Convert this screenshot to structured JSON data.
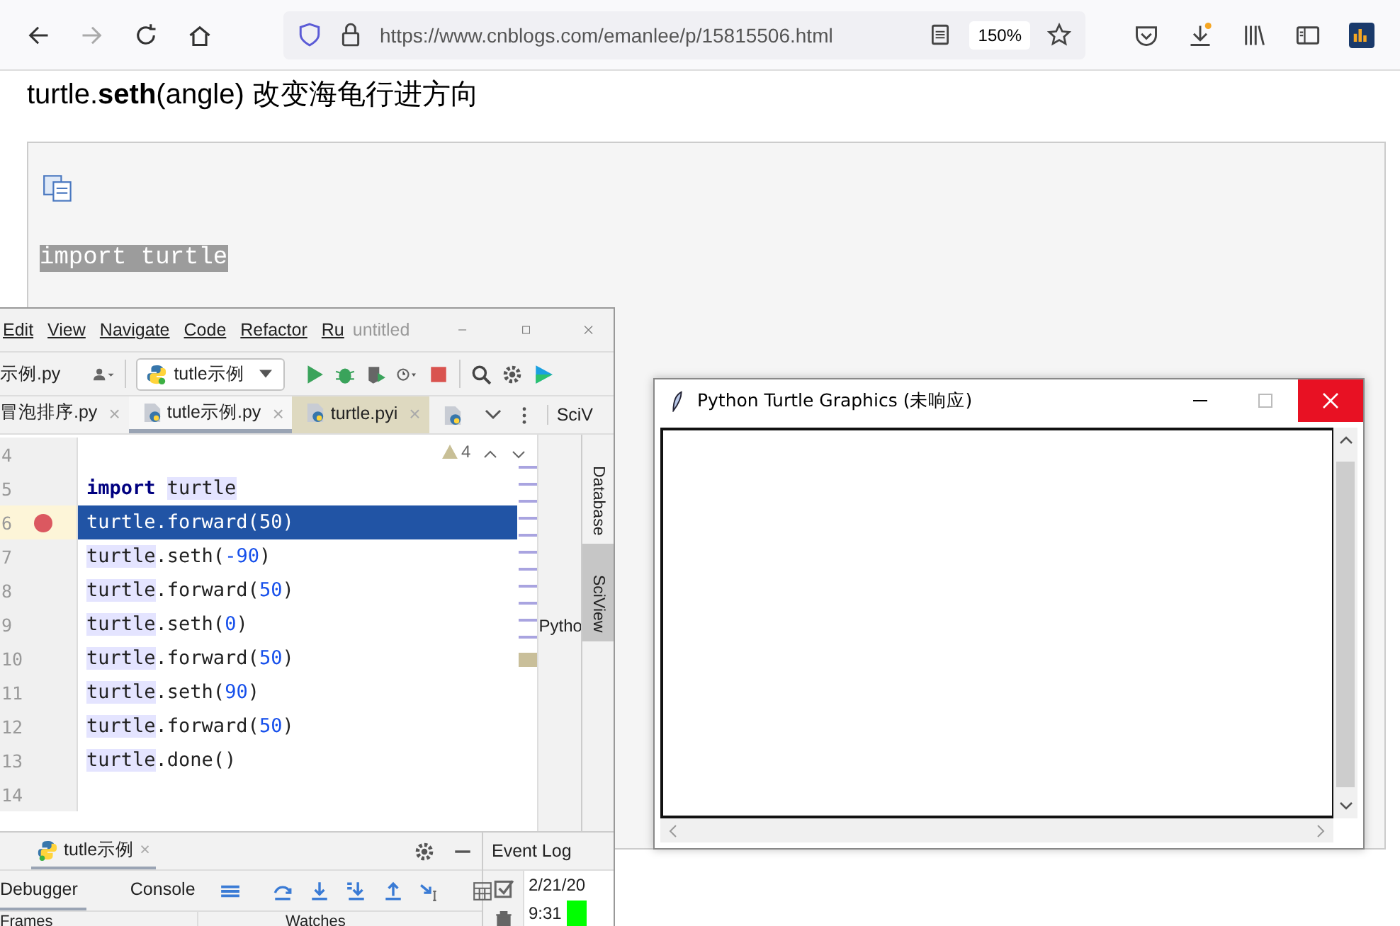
{
  "browser": {
    "url": "https://www.cnblogs.com/emanlee/p/15815506.html",
    "zoom": "150%"
  },
  "article": {
    "heading": "turtle.**seth**(angle) 改变海龟行进方向",
    "code_line": "import turtle",
    "code_selected": true
  },
  "ide": {
    "menu": [
      "Edit",
      "View",
      "Navigate",
      "Code",
      "Refactor",
      "Ru"
    ],
    "project": "untitled",
    "current_file": "示例.py",
    "run_config": "tutle示例",
    "tabs": [
      {
        "label": "冒泡排序.py",
        "kind": "plain",
        "selected": false,
        "close": "×"
      },
      {
        "label": "tutle示例.py",
        "kind": "python",
        "selected": true,
        "close": "×"
      },
      {
        "label": "turtle.pyi",
        "kind": "stub",
        "selected": false,
        "close": "×"
      }
    ],
    "panel_tab": "SciV",
    "side_tabs": [
      {
        "label": "Database",
        "selected": false
      },
      {
        "label": "SciView",
        "selected": true
      }
    ],
    "warnings": "4",
    "lines": [
      {
        "number": "4",
        "breakpoint": false,
        "selected": false
      },
      {
        "number": "5",
        "breakpoint": false,
        "selected": false,
        "tokens": [
          {
            "text": "import",
            "kind": "keyword"
          },
          {
            "text": "turtle",
            "kind": "ref"
          }
        ]
      },
      {
        "number": "6",
        "breakpoint": true,
        "selected": true,
        "tokens": [
          {
            "text": "turtle",
            "kind": "ref"
          },
          {
            "text": ".forward(",
            "kind": "plain"
          },
          {
            "text": "50",
            "kind": "number"
          },
          {
            "text": ")",
            "kind": "plain"
          }
        ]
      },
      {
        "number": "7",
        "breakpoint": false,
        "selected": false,
        "tokens": [
          {
            "text": "turtle",
            "kind": "ref"
          },
          {
            "text": ".seth(",
            "kind": "plain"
          },
          {
            "text": "-90",
            "kind": "number"
          },
          {
            "text": ")",
            "kind": "plain"
          }
        ]
      },
      {
        "number": "8",
        "breakpoint": false,
        "selected": false,
        "tokens": [
          {
            "text": "turtle",
            "kind": "ref"
          },
          {
            "text": ".forward(",
            "kind": "plain"
          },
          {
            "text": "50",
            "kind": "number"
          },
          {
            "text": ")",
            "kind": "plain"
          }
        ]
      },
      {
        "number": "9",
        "breakpoint": false,
        "selected": false,
        "tokens": [
          {
            "text": "turtle",
            "kind": "ref"
          },
          {
            "text": ".seth(",
            "kind": "plain"
          },
          {
            "text": "0",
            "kind": "number"
          },
          {
            "text": ")",
            "kind": "plain"
          }
        ]
      },
      {
        "number": "10",
        "breakpoint": false,
        "selected": false,
        "tokens": [
          {
            "text": "turtle",
            "kind": "ref"
          },
          {
            "text": ".forward(",
            "kind": "plain"
          },
          {
            "text": "50",
            "kind": "number"
          },
          {
            "text": ")",
            "kind": "plain"
          }
        ]
      },
      {
        "number": "11",
        "breakpoint": false,
        "selected": false,
        "tokens": [
          {
            "text": "turtle",
            "kind": "ref"
          },
          {
            "text": ".seth(",
            "kind": "plain"
          },
          {
            "text": "90",
            "kind": "number"
          },
          {
            "text": ")",
            "kind": "plain"
          }
        ]
      },
      {
        "number": "12",
        "breakpoint": false,
        "selected": false,
        "tokens": [
          {
            "text": "turtle",
            "kind": "ref"
          },
          {
            "text": ".forward(",
            "kind": "plain"
          },
          {
            "text": "50",
            "kind": "number"
          },
          {
            "text": ")",
            "kind": "plain"
          }
        ]
      },
      {
        "number": "13",
        "breakpoint": false,
        "selected": false,
        "tokens": [
          {
            "text": "turtle",
            "kind": "ref"
          },
          {
            "text": ".done()",
            "kind": "plain"
          }
        ]
      },
      {
        "number": "14",
        "breakpoint": false,
        "selected": false
      }
    ],
    "sciview_text": "Pytho",
    "debug": {
      "session": "tutle示例",
      "session_close": "×",
      "tabs": [
        {
          "label": "Debugger",
          "selected": true
        },
        {
          "label": "Console",
          "selected": false
        }
      ],
      "panels": [
        "Frames",
        "Watches"
      ]
    },
    "event_log": {
      "title": "Event Log",
      "date": "2/21/20",
      "time": "9:31"
    }
  },
  "turtle_window": {
    "title": "Python Turtle Graphics (未响应)"
  }
}
